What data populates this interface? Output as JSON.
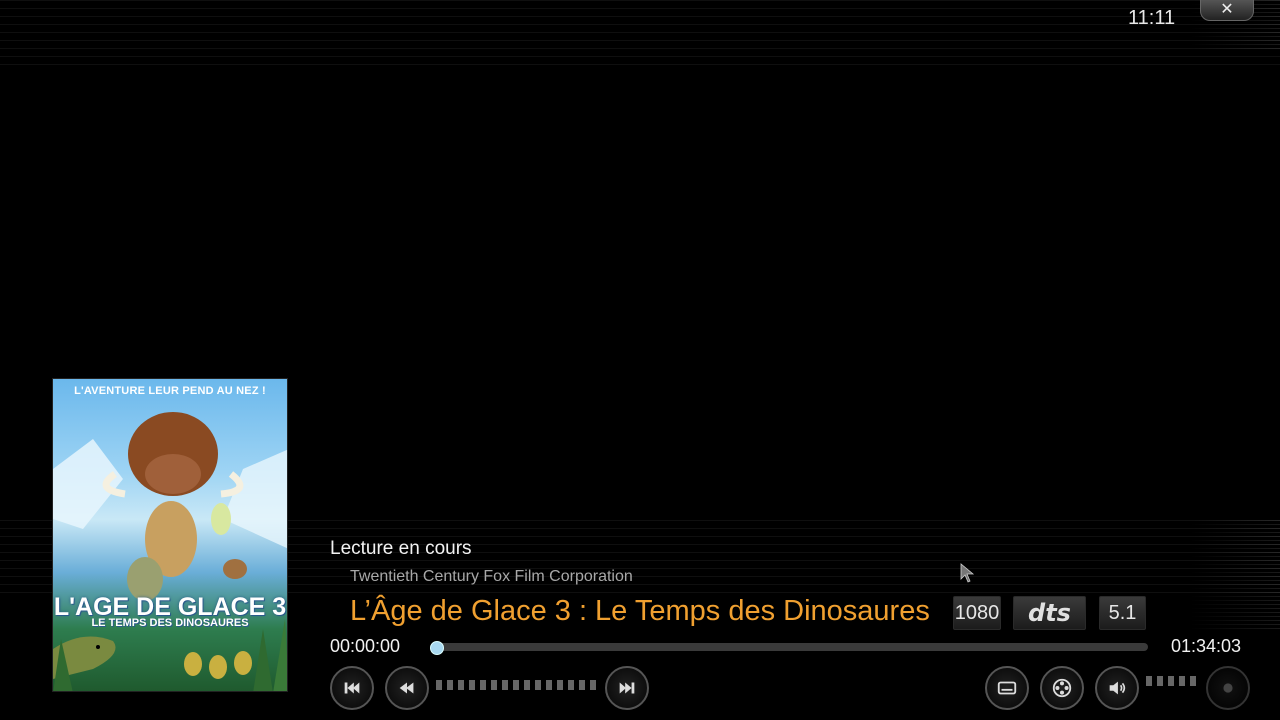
{
  "topbar": {
    "clock": "11:11",
    "close_glyph": "✕"
  },
  "poster": {
    "tagline": "L'AVENTURE LEUR PEND AU NEZ !",
    "title_line1": "L'AGE DE GLACE 3",
    "title_line2": "LE TEMPS DES DINOSAURES"
  },
  "now_playing": {
    "status": "Lecture en cours",
    "studio": "Twentieth Century Fox Film Corporation",
    "title": "L’Âge de Glace 3 : Le Temps des Dinosaures"
  },
  "badges": {
    "resolution": "1080",
    "audio_codec": "dts",
    "channels": "5.1"
  },
  "playback": {
    "elapsed": "00:00:00",
    "duration": "01:34:03",
    "progress_fraction": 0.0
  },
  "controls": {
    "left": [
      "skip-previous-icon",
      "rewind-icon",
      "fast-forward-icon"
    ],
    "right": [
      "subtitles-icon",
      "video-settings-icon",
      "audio-settings-icon",
      "record-icon"
    ]
  },
  "colors": {
    "title": "#f0a030",
    "progress_knob": "#a8d8f0"
  }
}
